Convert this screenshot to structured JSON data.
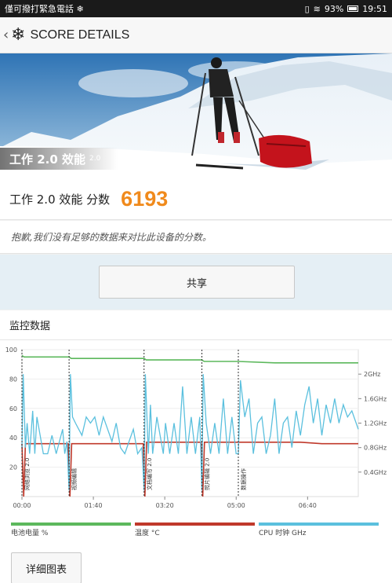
{
  "status_bar": {
    "left_text": "僅可撥打緊急電話 ❄",
    "battery": "93%",
    "time": "19:51"
  },
  "app_bar": {
    "title": "SCORE DETAILS",
    "back_icon": "chevron-left-icon",
    "logo_icon": "snowflake-logo-icon"
  },
  "hero": {
    "title": "工作 2.0 效能",
    "version": "2.0"
  },
  "score": {
    "label": "工作 2.0 效能 分数",
    "value": "6193",
    "color": "#f08a1c"
  },
  "notice": "抱歉,我们没有足够的数据来对比此设备的分数。",
  "share_button": "共享",
  "monitor": {
    "title": "监控数据",
    "detail_button": "详细图表"
  },
  "chart_data": {
    "type": "line",
    "x_ticks": [
      "00:00",
      "01:40",
      "03:20",
      "05:00",
      "06:40"
    ],
    "y_left_ticks": [
      "100",
      "80",
      "60",
      "40",
      "20"
    ],
    "y_left_range": [
      0,
      100
    ],
    "y_right_ticks": [
      "2GHz",
      "1.6GHz",
      "1.2GHz",
      "0.8GHz",
      "0.4GHz"
    ],
    "y_right_range": [
      0,
      2.4
    ],
    "x_range_minutes": [
      0,
      7.85
    ],
    "markers": [
      {
        "label": "网络浏览 2.0",
        "x": 0.0
      },
      {
        "label": "视频编辑",
        "x": 1.1
      },
      {
        "label": "文档编写 2.0",
        "x": 2.85
      },
      {
        "label": "照片编辑 2.0",
        "x": 4.2
      },
      {
        "label": "数据操作",
        "x": 5.05
      }
    ],
    "series": [
      {
        "name": "电池电量 %",
        "color": "#5cb85c",
        "x": [
          0,
          0.05,
          1.1,
          1.15,
          2.85,
          2.9,
          4.2,
          4.25,
          5.05,
          5.9,
          7.85
        ],
        "values": [
          96,
          95,
          95,
          94,
          94,
          93,
          93,
          92,
          92,
          91,
          91
        ]
      },
      {
        "name": "温度 °C",
        "color": "#c0392b",
        "x": [
          0,
          0.04,
          0.08,
          1.08,
          1.12,
          1.16,
          2.83,
          2.87,
          2.91,
          4.18,
          4.22,
          4.26,
          5.05,
          6.5,
          7.0,
          7.85
        ],
        "values": [
          36,
          0,
          36,
          36,
          0,
          36,
          36,
          0,
          37,
          37,
          0,
          37,
          37,
          37,
          36,
          36
        ]
      },
      {
        "name": "CPU 时钟 GHz",
        "color": "#5bc0de",
        "x": [
          0,
          0.03,
          0.08,
          0.12,
          0.18,
          0.25,
          0.3,
          0.35,
          0.5,
          0.6,
          0.7,
          0.8,
          0.95,
          1.0,
          1.05,
          1.1,
          1.13,
          1.18,
          1.25,
          1.4,
          1.5,
          1.6,
          1.7,
          1.8,
          1.9,
          2.0,
          2.1,
          2.2,
          2.3,
          2.4,
          2.5,
          2.6,
          2.7,
          2.8,
          2.85,
          2.88,
          2.95,
          3.0,
          3.05,
          3.15,
          3.3,
          3.35,
          3.45,
          3.55,
          3.65,
          3.75,
          3.85,
          3.95,
          4.05,
          4.15,
          4.2,
          4.23,
          4.3,
          4.4,
          4.5,
          4.6,
          4.7,
          4.8,
          4.9,
          5.0,
          5.05,
          5.1,
          5.2,
          5.3,
          5.4,
          5.5,
          5.6,
          5.7,
          5.8,
          5.9,
          6.0,
          6.1,
          6.2,
          6.3,
          6.4,
          6.5,
          6.6,
          6.7,
          6.8,
          6.9,
          7.0,
          7.1,
          7.2,
          7.3,
          7.4,
          7.5,
          7.6,
          7.7,
          7.85
        ],
        "values": [
          0.8,
          2.0,
          0.8,
          1.2,
          0.7,
          1.4,
          0.7,
          1.3,
          0.7,
          0.7,
          1.0,
          0.7,
          1.1,
          0.7,
          0.9,
          0.1,
          2.0,
          1.3,
          1.2,
          1.0,
          1.3,
          1.2,
          1.3,
          1.0,
          1.3,
          1.1,
          0.9,
          1.2,
          0.8,
          0.7,
          0.9,
          1.1,
          0.7,
          0.8,
          0.1,
          2.0,
          0.7,
          1.5,
          0.7,
          1.3,
          0.7,
          1.2,
          0.7,
          1.2,
          0.7,
          1.8,
          0.7,
          1.3,
          0.7,
          1.3,
          0.1,
          2.0,
          1.2,
          0.7,
          1.2,
          0.7,
          1.6,
          0.7,
          1.3,
          0.7,
          0.7,
          1.9,
          1.3,
          1.6,
          0.7,
          1.2,
          1.3,
          0.7,
          1.0,
          1.6,
          0.7,
          1.2,
          1.3,
          0.8,
          1.4,
          1.0,
          1.5,
          1.8,
          1.2,
          1.6,
          1.0,
          1.5,
          1.2,
          1.6,
          1.2,
          1.5,
          1.3,
          1.4,
          1.1
        ]
      }
    ]
  }
}
